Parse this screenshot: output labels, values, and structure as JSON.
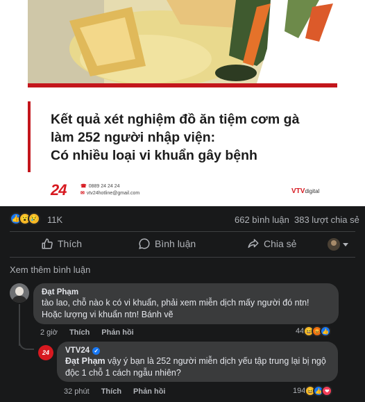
{
  "news_card": {
    "headline_lines": [
      "Kết quả xét nghiệm đồ ăn tiệm cơm gà",
      "làm 252 người nhập viện:",
      "Có nhiều loại vi khuẩn gây bệnh"
    ],
    "brand_logo": "24",
    "phone": "0889 24 24 24",
    "email": "vtv24hotline@gmail.com",
    "channel_logo_main": "VTV",
    "channel_logo_sub": "digital",
    "accent_color": "#c3161c"
  },
  "stats": {
    "reaction_icons": [
      "like-icon",
      "wow-icon",
      "sad-icon"
    ],
    "reaction_count": "11K",
    "comment_count": "662 bình luận",
    "share_count": "383 lượt chia sẻ"
  },
  "actions": {
    "like_label": "Thích",
    "comment_label": "Bình luận",
    "share_label": "Chia sẻ"
  },
  "more_comments_label": "Xem thêm bình luận",
  "comments": [
    {
      "author": "Đạt Phạm",
      "text": "tào lao, chỗ nào k có vi khuẩn, phải xem miễn dịch mấy người đó ntn! Hoặc lượng vi khuẩn ntn! Bánh vẽ",
      "time": "2 giờ",
      "like_label": "Thích",
      "reply_label": "Phản hồi",
      "reaction_total": "44"
    },
    {
      "author": "VTV24",
      "verified": true,
      "mention": "Đạt Phạm",
      "text": " vậy ý bạn là 252 người miễn dịch yếu tập trung lại bị ngộ độc 1 chỗ 1 cách ngẫu nhiên?",
      "time": "32 phút",
      "like_label": "Thích",
      "reply_label": "Phản hồi",
      "reaction_total": "194",
      "avatar_text": "24"
    }
  ]
}
